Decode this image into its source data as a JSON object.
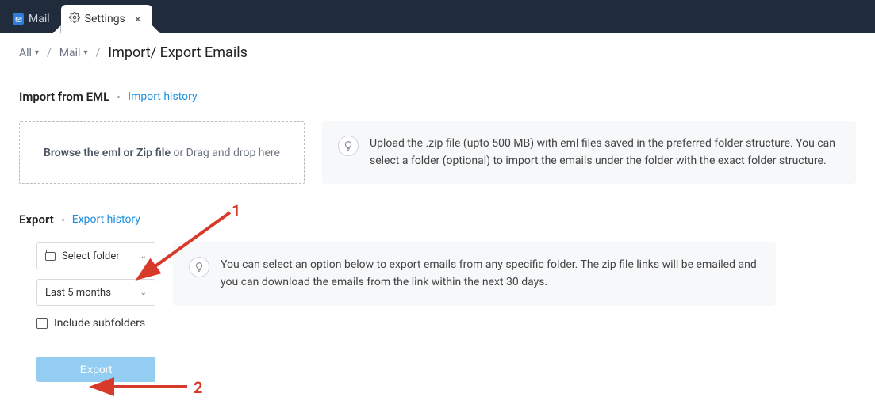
{
  "tabs": {
    "mail": {
      "label": "Mail"
    },
    "settings": {
      "label": "Settings"
    }
  },
  "breadcrumb": {
    "all": "All",
    "mail": "Mail",
    "current": "Import/ Export Emails"
  },
  "import": {
    "title": "Import from EML",
    "history_link": "Import history",
    "dropzone_bold": "Browse the eml or Zip file",
    "dropzone_rest": " or Drag and drop here",
    "tip": "Upload the .zip file (upto 500 MB) with eml files saved in the preferred folder structure. You can select a folder (optional) to import the emails under the folder with the exact folder structure."
  },
  "export": {
    "title": "Export",
    "history_link": "Export history",
    "select_folder": "Select folder",
    "range": "Last 5 months",
    "include_subfolders": "Include subfolders",
    "button": "Export",
    "tip": "You can select an option below to export emails from any specific folder. The zip file links will be emailed and you can download the emails from the link within the next 30 days."
  },
  "annotations": {
    "one": "1",
    "two": "2"
  }
}
